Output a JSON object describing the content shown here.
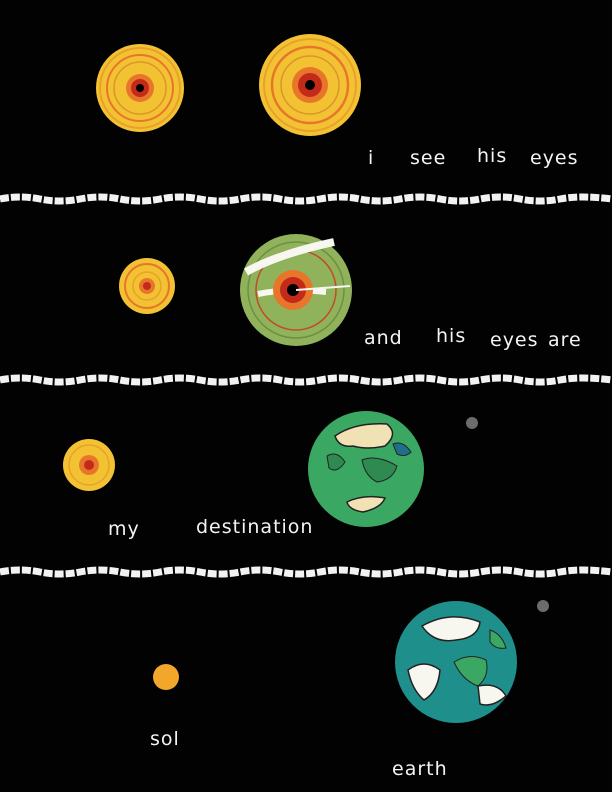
{
  "panels": [
    {
      "caption": [
        "i",
        "see",
        "his",
        "eyes"
      ]
    },
    {
      "caption": [
        "and",
        "his",
        "eyes",
        "are"
      ]
    },
    {
      "caption": [
        "my",
        "destination"
      ]
    },
    {
      "caption_left": "sol",
      "caption_right": "earth"
    }
  ],
  "colors": {
    "background": "#020202",
    "sun_yellow": "#f2c233",
    "sun_orange": "#e8762a",
    "sun_red": "#c42a1a",
    "iris_green": "#8fb25a",
    "earth_green": "#3aa862",
    "ocean_teal": "#1f8f8c",
    "land_cream": "#f1e2b5",
    "cloud_white": "#f7f7f0",
    "moon_gray": "#6c6c6c",
    "divider_white": "#f2f2f2"
  },
  "icons": [
    "sun-eye-icon",
    "green-eye-icon",
    "earth-icon",
    "moon-icon",
    "sun-icon"
  ]
}
